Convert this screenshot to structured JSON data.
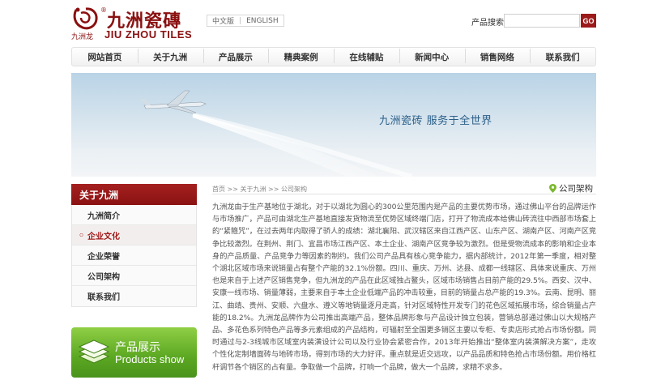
{
  "header": {
    "logo_cn": "九洲瓷磚",
    "logo_reg": "®",
    "logo_sub": "九洲龙",
    "logo_en": "JIU ZHOU TILES",
    "lang_cn": "中文版",
    "lang_sep": "|",
    "lang_en": "ENGLISH",
    "search_label": "产品搜索：",
    "search_value": "",
    "search_btn": "GO"
  },
  "nav": {
    "items": [
      "网站首页",
      "关于九洲",
      "产品展示",
      "精典案例",
      "在线辅贴",
      "新闻中心",
      "销售网络",
      "联系我们"
    ]
  },
  "banner": {
    "slogan": "九洲瓷砖  服务于全世界"
  },
  "sidebar": {
    "title": "关于九洲",
    "items": [
      "九洲简介",
      "企业文化",
      "企业荣誉",
      "公司架构",
      "联系我们"
    ],
    "active_index": 1
  },
  "promo": {
    "cn": "产品展示",
    "en": "Products show"
  },
  "breadcrumb": {
    "text": "首页 >> 关于九洲 >> 公司架构",
    "title": "公司架构"
  },
  "article": {
    "text": "九洲龙由于生产基地位于湖北，对于以湖北为圆心的300公里范围内是产品的主要优势市场，通过佛山平台的品牌运作与市场推广，产品可由湖北生产基地直接发货物流至优势区域终端门店，打开了物流成本给佛山砖流往中西部市场套上的“紧箍咒”，在过去两年内取得了骄人的成绩：湖北襄阳、武汉辖区来自江西产区、山东产区、湖南产区、河南产区竞争比较激烈。在荆州、荆门、宜昌市场江西产区、本土企业、湖南产区竞争较为激烈。但是受物流成本的影响和企业本身的产品质量、产品竞争力等因素的制约。我们公司产品具有核心竞争能力，据内部统计，2012年第一季度，相对整个湖北区域市场来说销量占有整个产能的32.1%份额。四川、重庆、万州、达县、成都一线辖区、具体来说重庆、万州也是来自于上述产区销售竞争，但九洲龙的产品在此区域独占鳌头，区域市场销售占目前产能的29.5%。西安、汉中、安康一线市场、销量薄弱，主要来自于本土企业低端产品的冲击较重，目前的销量占总产能的19.3%。云南、昆明、丽江、曲靖、贵州、安顺、六盘水、遵义等地销量逐月走高，针对区域特性开发专门的花色区域拓展市场，综合销量占产能的18.2%。九洲龙品牌作为公司推出高端产品，整体品牌形象与产品设计独立包装，营销总部通过佛山以大规格产品、多花色系列特色产品等多元素组成的产品结构，可辐射至全国更多销区主要以专柜、专卖店形式抢占市场份额。同时通过与2-3线城市区域室内装潢设计公司以及行业协会紧密合作，2013年开始推出“整体室内装潢解决方案”，走攻个性化定制墙面砖与地砖市场，得到市场的大力好评。重点就是近交远攻，以产品品质和特色抢占市场份额。用价格杠杆调节各个销区的占有量。争取做一个品牌，打响一个品牌，做大一个品牌，求精不求多。"
  },
  "colors": {
    "brand_red": "#8a1212",
    "promo_green": "#5ba722",
    "slogan_blue": "#2b5f88"
  }
}
